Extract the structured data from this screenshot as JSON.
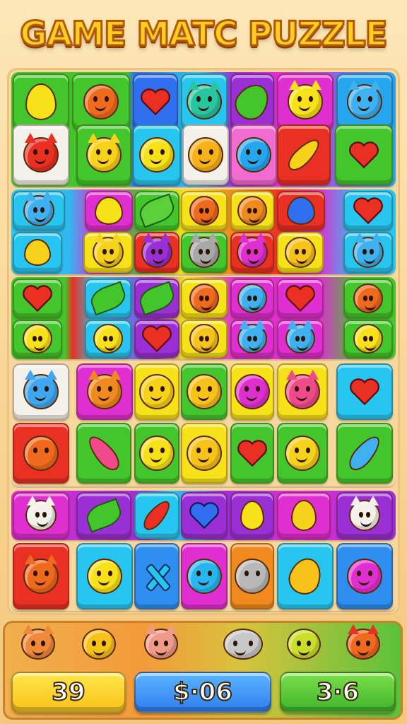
{
  "title": "GAME MATC PUZZLE",
  "colors": {
    "green": "#43c62b",
    "blue": "#2f8ff0",
    "cyan": "#27c6f0",
    "purple": "#9b2fd6",
    "magenta": "#e02fd0",
    "yellow": "#f7e21a",
    "red": "#ea2f23",
    "orange": "#f08a1e",
    "white": "#f4f0ea",
    "pink": "#f26bd0"
  },
  "board": {
    "rows": [
      [
        "pear",
        "orange-face",
        "heart",
        "cat-face",
        "bottle",
        "cat-face",
        "cat-face"
      ],
      [
        "cat-face",
        "cat-face",
        "face",
        "sun-face",
        "bird-face",
        "pencil",
        "heart"
      ],
      [
        "cat-face",
        "leaf",
        "leaf",
        "orange-face",
        "orange-face",
        "flower",
        "heart"
      ],
      [
        "leaf",
        "cat-face",
        "cat-face",
        "cat-face",
        "cat-face",
        "face",
        "cat-face"
      ],
      [
        "heart",
        "leaf",
        "leaf",
        "orange-face",
        "face",
        "heart",
        "orange-face"
      ],
      [
        "face",
        "face",
        "heart",
        "face",
        "cat-face",
        "cat-face",
        "face"
      ],
      [
        "cat-face",
        "cat-face",
        "face",
        "sun-face",
        "bird-face",
        "cat-face",
        "heart"
      ],
      [
        "tomato",
        "pencil",
        "face",
        "face",
        "heart",
        "face",
        "pencil"
      ],
      [
        "cat-face",
        "leaf",
        "pencil",
        "heart",
        "pear",
        "bell",
        "cat-face"
      ],
      [
        "cat-face",
        "sun-face",
        "cross",
        "bird-face",
        "bomb",
        "pear",
        "berry"
      ]
    ]
  },
  "bottom_bar": {
    "pieces": [
      "fox-face",
      "face",
      "cat-face",
      "seal-face",
      "frog-face",
      "dragon-face"
    ],
    "scores": [
      "39",
      "$·06",
      "3·6"
    ]
  }
}
